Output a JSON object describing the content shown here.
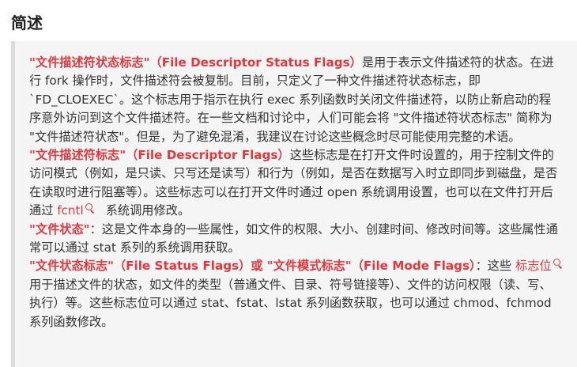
{
  "heading": "简述",
  "paragraphs": [
    {
      "term": "\"文件描述符状态标志\"（File Descriptor Status Flags）",
      "text": "是用于表示文件描述符的状态。在进行 fork 操作时，文件描述符会被复制。目前，只定义了一种文件描述符状态标志，即 `FD_CLOEXEC`。这个标志用于指示在执行 exec 系列函数时关闭文件描述符，以防止新启动的程序意外访问到这个文件描述符。在一些文档和讨论中，人们可能会将 \"文件描述符状态标志\" 简称为 \"文件描述符状态\"。但是，为了避免混淆，我建议在讨论这些概念时尽可能使用完整的术语。"
    },
    {
      "term": "\"文件描述符标志\"（File Descriptor Flags）",
      "text": "这些标志是在打开文件时设置的，用于控制文件的访问模式（例如，是只读、只写还是读写）和行为（例如，是否在数据写入时立即同步到磁盘，是否在读取时进行阻塞等）。这些标志可以在打开文件时通过 open 系统调用设置，也可以在文件打开后通过 ",
      "link": "fcntl",
      "text_after": "系统调用修改。"
    },
    {
      "term": "\"文件状态\"",
      "text": "：这是文件本身的一些属性，如文件的权限、大小、创建时间、修改时间等。这些属性通常可以通过 stat 系列的系统调用获取。"
    },
    {
      "term": "\"文件状态标志\"（File Status Flags）或 \"文件模式标志\"（File Mode Flags）",
      "text": "：这些 ",
      "link": "标志位",
      "text_after": "用于描述文件的状态，如文件的类型（普通文件、目录、符号链接等）、文件的访问权限（读、写、执行）等。这些标志位可以通过 stat、fstat、lstat 系列函数获取，也可以通过 chmod、fchmod 系列函数修改。"
    }
  ]
}
